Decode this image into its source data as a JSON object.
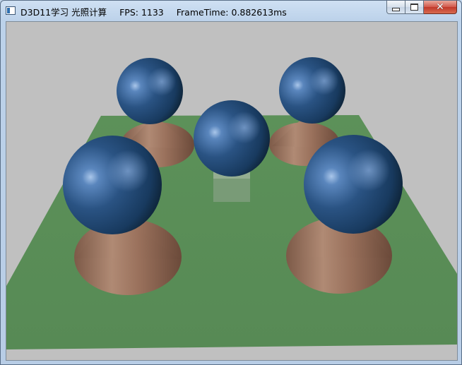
{
  "window": {
    "title": "D3D11学习 光照计算",
    "fps_text": "FPS: 1133",
    "frametime_text": "FrameTime: 0.882613ms"
  },
  "icons": [
    "app-window-icon",
    "minimize-icon",
    "maximize-icon",
    "close-icon"
  ],
  "scene": {
    "background_color": "#c0c0c0",
    "ground_color": "#5a9058",
    "sphere_color": "#1f4770",
    "cone_color": "#9c7460",
    "box_color": "#7a9a78"
  }
}
